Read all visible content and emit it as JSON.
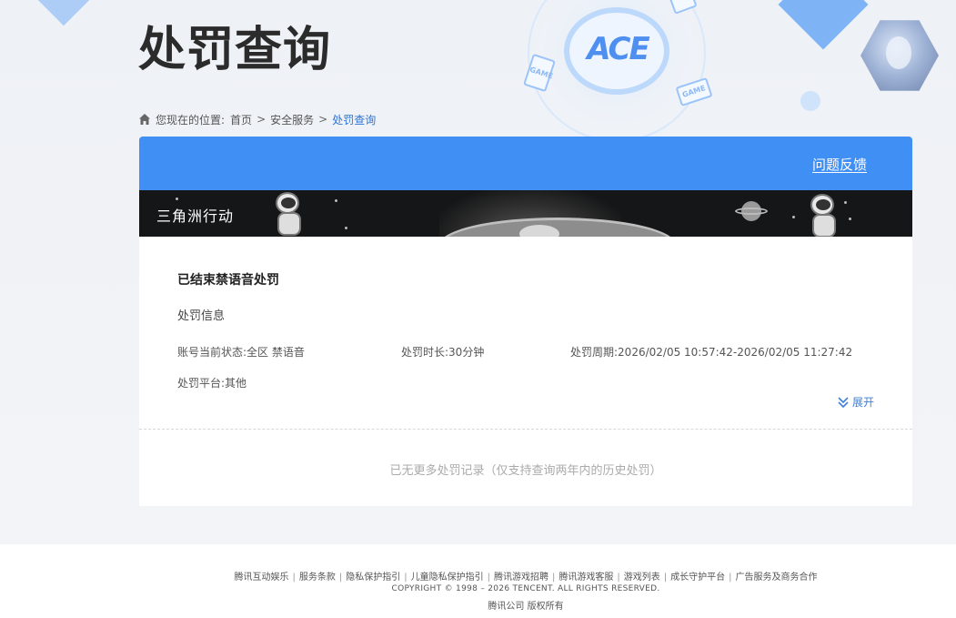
{
  "page": {
    "title": "处罚查询"
  },
  "breadcrumb": {
    "prefix": "您现在的位置:",
    "items": [
      "首页",
      "安全服务"
    ],
    "separator": ">",
    "current": "处罚查询"
  },
  "panel": {
    "feedback_label": "问题反馈",
    "game_name": "三角洲行动",
    "record": {
      "title": "已结束禁语音处罚",
      "info_heading": "处罚信息",
      "account_status_label": "账号当前状态:",
      "account_status_value": "全区 禁语音",
      "duration_label": "处罚时长:",
      "duration_value": "30分钟",
      "period_label": "处罚周期:",
      "period_value": "2026/02/05 10:57:42-2026/02/05 11:27:42",
      "platform_label": "处罚平台:",
      "platform_value": "其他",
      "expand_label": "展开"
    },
    "no_more_text": "已无更多处罚记录（仅支持查询两年内的历史处罚）"
  },
  "footer": {
    "links": [
      "腾讯互动娱乐",
      "服务条款",
      "隐私保护指引",
      "儿童隐私保护指引",
      "腾讯游戏招聘",
      "腾讯游戏客服",
      "游戏列表",
      "成长守护平台",
      "广告服务及商务合作"
    ],
    "separator": "|",
    "copyright": "COPYRIGHT © 1998 – 2026 TENCENT. ALL RIGHTS RESERVED.",
    "company": "腾讯公司 版权所有"
  },
  "decor": {
    "logo_text": "ACE",
    "tag_text": "GAME"
  },
  "colors": {
    "accent": "#3f8ff5",
    "link": "#2f74d4",
    "banner_bg": "#151617",
    "muted_text": "#aaaaaa"
  }
}
